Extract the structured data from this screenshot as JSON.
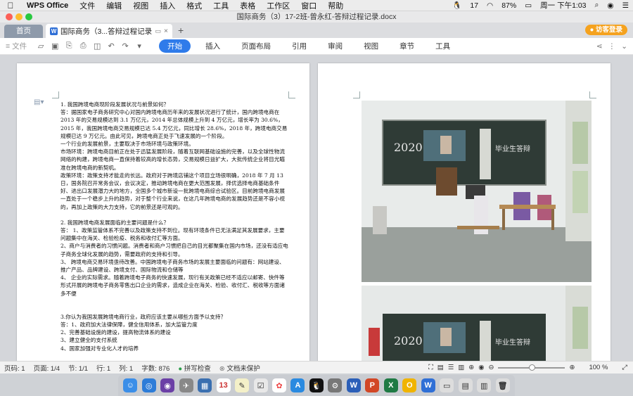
{
  "menubar": {
    "app_name": "WPS Office",
    "items": [
      "文件",
      "编辑",
      "视图",
      "插入",
      "格式",
      "工具",
      "表格",
      "工作区",
      "窗口",
      "帮助"
    ],
    "status": {
      "badge": "17",
      "battery": "87%",
      "clock": "周一 下午1:03"
    }
  },
  "window": {
    "title": "国际商务（3）17-2班-曾永红-答辩过程记录.docx"
  },
  "tabs": {
    "home": "首页",
    "doc": "国际商务（3...答辩过程记录",
    "visitor_login": "访客登录"
  },
  "ribbon": {
    "file": "文件",
    "tabs": [
      "开始",
      "插入",
      "页面布局",
      "引用",
      "审阅",
      "视图",
      "章节",
      "工具"
    ],
    "active": "开始"
  },
  "document": {
    "paragraphs": [
      "1. 我国跨境电商现阶段发展状况与前景如何？",
      "答：据国家电子商务研究中心对国内跨境电商历年来的发展状况进行了统计，国内跨境电商在 2013 年的交易规模达到 3.1 万亿元，2014 年总体规模上升到 4 万亿元，增长率为 30.6%，2015 年，我国跨境电商交易规模已达 5.4 万亿元，同比增长 28.6%，2018 年，跨境电商交易规模已达 9 万亿元。由此可见，跨境电商正处于飞速发展的一个阶段。",
      "一个行业的发展前景，主要取决于市场环境与政策环境。",
      "市场环境：跨境电商目前正在处于迅猛发展阶段，随着互联网基础设施的完善，以及全球性物流网络的构建，跨境电商一直保持着较高的增长态势，交易规模日益扩大，大批传统企业将目光瞄准在跨境电商的新契机。",
      "政策环境：政策支持才能走的长远。政府对于跨境店铺这个项目立场很明确，2018 年 7 月 13 日，国务院召开常务会议，会议决定，推动跨境电商在更大范围发展，择优选择电商基础条件好、进出口发展潜力大的地方，全国多个城市新设一批跨境电商综合试验区。目前跨境电商发展一直处于一个稳步上升的趋势，对于整个行业来说，在这几年跨境电商的发展趋势还是不容小视的，再加上政策的大力支持，它的前景还是可观的。",
      "",
      "2. 我国跨境电商发展面临的主要问题是什么？",
      "答：  1、政策监管体系不完善以及政策支持不到位。现有环境条件已无法满足其发展要求，主要问题集中在海关、检验检疫、税务和收付汇等方面。",
      "2、商户与消费者的习惯问题。消费者和商户习惯把自己的目光都聚集在国内市场，还没有适应电子商务全球化发展的趋势，需要政府的支持和引导。",
      "3、  跨境电商交易环境亟待改善。中国跨境电子商务市场的发展主要面临的问题有：网站建设、推广产品、品牌建设、跨境支付、国际物流和仓储等",
      "4、  企业的实际需求。随着跨境电子商务的快速发展，现行有关政策已经不适应以邮寄、快件等形式开展的跨境电子商务零售出口企业的需求，造成企业在海关、检验、收付汇、税收等方面诸多不便",
      "",
      "",
      "3.你认为我国发展跨境电商行业，政府应该主要从哪些方面予以支持？",
      "答：1、政府加大法律保障，健全信用体系，加大监管力度",
      "2、完善基础设施的建设，提高物流体系的建设",
      "3、建立健全的支付系统",
      "4、国家加强对专业化人才的培养"
    ]
  },
  "photos": [
    {
      "board_text": "2020",
      "board_text2": "毕业生答辩"
    },
    {
      "board_text": "2020",
      "board_text2": "毕业生答辩"
    }
  ],
  "statusbar": {
    "page_no": "页码: 1",
    "page": "页面: 1/4",
    "section": "节: 1/1",
    "row": "行: 1",
    "col": "列: 1",
    "words": "字数: 876",
    "spellcheck": "拼写检查",
    "unprotected": "文档未保护",
    "zoom": "100 %"
  },
  "colors": {
    "accent": "#2f7bea",
    "visitor": "#f5a21e"
  }
}
